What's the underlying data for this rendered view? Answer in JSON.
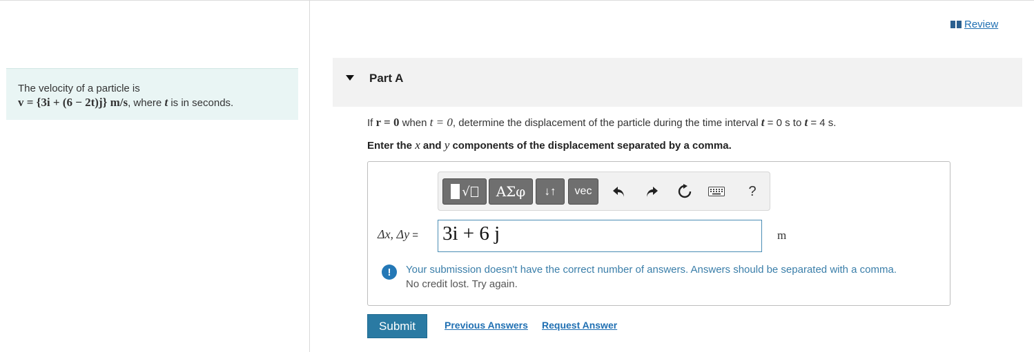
{
  "review": {
    "label": "Review",
    "icon": "book-icon"
  },
  "problem": {
    "intro": "The velocity of a particle is",
    "formula": "v = {3i + (6 − 2t)j} m/s",
    "suffix_1": ", where ",
    "var_t": "t",
    "suffix_2": " is in seconds."
  },
  "part": {
    "title": "Part A",
    "collapse_icon": "caret-down-icon"
  },
  "question": {
    "p1": "If ",
    "cond_r": "r = 0",
    "p2": " when ",
    "cond_t": "t = 0",
    "p3": ", determine the displacement of the particle during the time interval ",
    "t_var1": "t",
    "t_start": " = 0 s to ",
    "t_var2": "t",
    "t_end": " = 4 s",
    "p4": "."
  },
  "instruction": {
    "p1": "Enter the ",
    "x": "x",
    "p2": " and ",
    "y": "y",
    "p3": " components of the displacement separated by a comma."
  },
  "toolbar": {
    "greek_label": "ΑΣφ",
    "arrows_label": "↓↑",
    "vec_label": "vec",
    "help_label": "?",
    "icons": [
      "templates-icon",
      "greek-letters-icon",
      "subscript-superscript-icon",
      "vector-icon",
      "undo-icon",
      "redo-icon",
      "reset-icon",
      "keyboard-icon",
      "help-icon"
    ]
  },
  "answer": {
    "label_math": "Δx, Δy",
    "label_eq": " =",
    "value": "3i + 6 j",
    "unit": "m"
  },
  "feedback": {
    "line1": "Your submission doesn't have the correct number of answers. Answers should be separated with a comma.",
    "line2": "No credit lost. Try again.",
    "icon_symbol": "!"
  },
  "actions": {
    "submit": "Submit",
    "previous": "Previous Answers",
    "request": "Request Answer"
  },
  "colors": {
    "accent": "#2a7aa3",
    "link": "#1f6fb2",
    "problem_bg": "#e9f5f4",
    "part_bg": "#f2f2f2",
    "feedback_text": "#3a7ea9"
  }
}
